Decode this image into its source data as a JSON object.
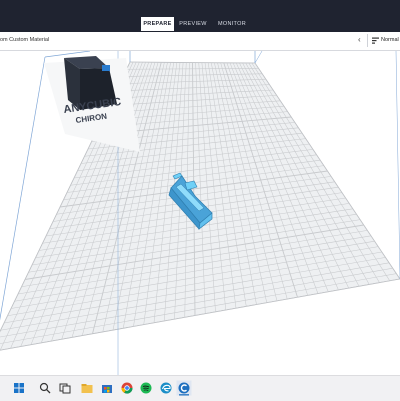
{
  "header": {
    "tabs": [
      {
        "label": "PREPARE",
        "active": true
      },
      {
        "label": "PREVIEW",
        "active": false
      },
      {
        "label": "MONITOR",
        "active": false
      }
    ]
  },
  "subbar": {
    "material_text": "om Custom Material",
    "profile_label": "Normal"
  },
  "printer_logo": {
    "brand_line1": "ANYCUBIC",
    "brand_line2": "CHIRON"
  },
  "taskbar": {
    "icons": [
      "windows-start-icon",
      "search-icon",
      "task-view-icon",
      "file-explorer-icon",
      "store-icon",
      "chrome-icon",
      "spotify-icon",
      "edge-icon",
      "cura-icon"
    ]
  },
  "colors": {
    "header_bg": "#1f2330",
    "grid_line": "#c8cacd",
    "plate": "#f0f1f3",
    "model": "#5ab8e8",
    "taskbar_bg": "#f1f1f3"
  }
}
